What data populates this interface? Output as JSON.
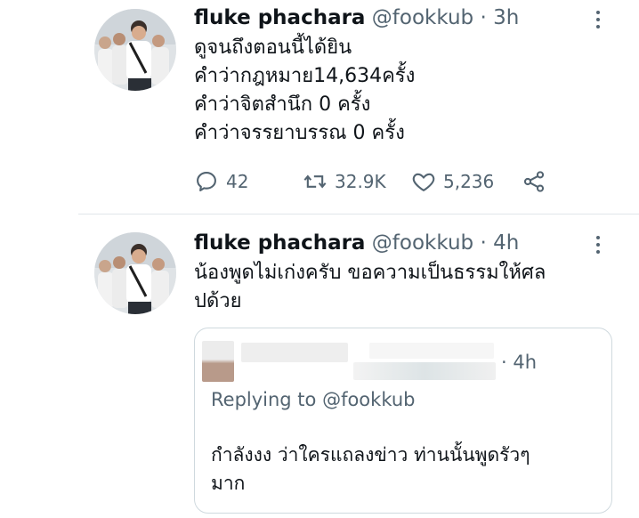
{
  "tweets": [
    {
      "author_name": "fluke phachara",
      "handle": "@fookkub",
      "separator": "·",
      "time": "3h",
      "lines": [
        "ดูจนถึงตอนนี้ได้ยิน",
        "คำว่ากฎหมาย14,634ครั้ง",
        "คำว่าจิตสำนึก 0 ครั้ง",
        "คำว่าจรรยาบรรณ 0 ครั้ง"
      ],
      "actions": {
        "replies": "42",
        "retweets": "32.9K",
        "likes": "5,236"
      },
      "icons": [
        "reply-icon",
        "retweet-icon",
        "like-icon",
        "share-icon",
        "more-icon"
      ]
    },
    {
      "author_name": "fluke phachara",
      "handle": "@fookkub",
      "separator": "·",
      "time": "4h",
      "lines": [
        "น้องพูดไม่เก่งครับ ขอความเป็นธรรมให้ศล",
        "ปด้วย"
      ],
      "quoted": {
        "separator_time": "· 4h",
        "replying_to": "Replying to @fookkub",
        "lines": [
          "กำลังงง ว่าใครแถลงข่าว ท่านนั้นพูดรัวๆ",
          "มาก"
        ]
      }
    }
  ],
  "colors": {
    "text": "#0f1419",
    "secondary": "#536471",
    "border": "#cfd9de"
  }
}
